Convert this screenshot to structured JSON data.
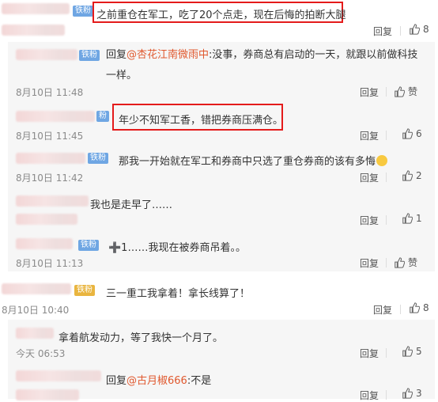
{
  "comments": [
    {
      "badge": "铁粉",
      "text": "之前重仓在军工，吃了20个点走，现在后悔的拍断大腿",
      "date": "",
      "reply": "回复",
      "likes": "8"
    },
    {
      "badge": "铁粉",
      "prefix": "回复",
      "mention": "@杏花江南微雨中",
      "text": ":没事，券商总有启动的一天，就跟以前做科技一样。",
      "date": "8月10日 11:48",
      "reply": "回复",
      "likes": "赞"
    },
    {
      "badge": "粉",
      "text": "年少不知军工香，错把券商压满仓。",
      "date": "8月10日 11:45",
      "reply": "回复",
      "likes": "6"
    },
    {
      "badge": "铁粉",
      "text": "那我一开始就在军工和券商中只选了重仓券商的该有多悔",
      "date": "8月10日 11:42",
      "reply": "回复",
      "likes": "2"
    },
    {
      "badge": "",
      "text": "我也是走早了……",
      "date": "",
      "reply": "回复",
      "likes": "1"
    },
    {
      "badge": "铁粉",
      "text": "➕1……我现在被券商吊着。。",
      "date": "8月10日 11:13",
      "reply": "回复",
      "likes": "赞"
    },
    {
      "badge": "铁粉",
      "text": "三一重工我拿着！拿长线算了！",
      "date": "8月10日 10:40",
      "reply": "回复",
      "likes": "8"
    },
    {
      "badge": "",
      "text": "拿着航发动力，等了我快一个月了。",
      "date": "今天 06:53",
      "reply": "回复",
      "likes": "5"
    },
    {
      "badge": "",
      "prefix": "回复",
      "mention": "@古月椒666",
      "text": ":不是",
      "date": "",
      "reply": "回复",
      "likes": "3"
    }
  ],
  "icons": {
    "thumb": "thumbs-up-icon",
    "emoji": "laughing-emoji-icon"
  },
  "colors": {
    "highlight": "#e41b1b",
    "mention": "#e0582e",
    "badge": "#6fa6e3",
    "badge_gold": "#e9b53f"
  }
}
